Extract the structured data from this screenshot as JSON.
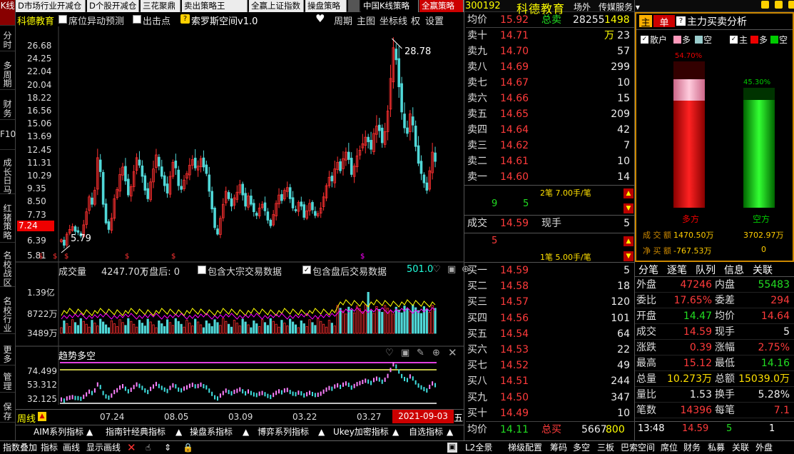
{
  "top_menu": [
    "D市场行业开减仓",
    "D个股开减仓",
    "三花聚鼎",
    "卖出策略王",
    "全赢上证指数",
    "操盘策略",
    "中国K线策略",
    "全赢策略"
  ],
  "stock": {
    "code": "300192",
    "name": "科德教育",
    "venue": "场外",
    "sector": "传媒服务 ▾"
  },
  "left_tabs": [
    "K线",
    "分时",
    "多周期",
    "财务",
    "F10",
    "成长日马",
    "红猪策略",
    "名校战区",
    "名校行业",
    "更多",
    "管理",
    "保存"
  ],
  "chart_header": {
    "name": "科德教育",
    "checkbox1": "席位异动预测",
    "checkbox2": "出击点",
    "indicator": "索罗斯空间v1.0",
    "menu": [
      "周期",
      "主图",
      "坐标线",
      "权",
      "设置"
    ]
  },
  "price_axis": [
    "26.68",
    "24.25",
    "22.04",
    "20.04",
    "18.22",
    "16.56",
    "15.06",
    "13.69",
    "12.45",
    "11.31",
    "10.29",
    "9.35",
    "8.50",
    "7.73",
    "7.24",
    "6.39",
    "5.81"
  ],
  "current_price_tag": "7.24",
  "annotations": {
    "high": "28.78",
    "low": "5.79"
  },
  "volume_panel": {
    "label": "成交量",
    "value": "4247.70万",
    "after_hours": "( 盘后: 0",
    "opt1": "包含大宗交易数据",
    "opt2": "包含盘后交易数据",
    "ma": "501.0",
    "axis": [
      "1.39亿",
      "8722万",
      "3489万"
    ]
  },
  "trend_panel": {
    "title": "趋势多空",
    "axis": [
      "74.499",
      "53.312",
      "32.125"
    ]
  },
  "date_axis": [
    "07.24",
    "08.05",
    "03.09",
    "03.22",
    "03.27"
  ],
  "period": "周线",
  "date_marker": "2021-09-03",
  "weekday": "五",
  "indicator_tabs": [
    "AIM系列指标",
    "指南针经典指标",
    "操盘系指标",
    "博弈系列指标",
    "Ukey加密指标",
    "自选指标"
  ],
  "order_book": {
    "avg_label": "均价",
    "avg": "15.92",
    "sell_total_label": "总卖",
    "sell_total": "28255",
    "sell_amount": "1498万",
    "asks": [
      {
        "l": "卖十",
        "p": "14.71",
        "v": "23"
      },
      {
        "l": "卖九",
        "p": "14.70",
        "v": "57"
      },
      {
        "l": "卖八",
        "p": "14.69",
        "v": "299"
      },
      {
        "l": "卖七",
        "p": "14.67",
        "v": "10"
      },
      {
        "l": "卖六",
        "p": "14.66",
        "v": "15"
      },
      {
        "l": "卖五",
        "p": "14.65",
        "v": "209"
      },
      {
        "l": "卖四",
        "p": "14.64",
        "v": "42"
      },
      {
        "l": "卖三",
        "p": "14.62",
        "v": "7"
      },
      {
        "l": "卖二",
        "p": "14.61",
        "v": "10"
      },
      {
        "l": "卖一",
        "p": "14.60",
        "v": "14"
      }
    ],
    "ask_info": "2笔 7.00手/笔",
    "ask_queue": [
      "9",
      "5"
    ],
    "trade_label": "成交",
    "trade_price": "14.59",
    "hand_label": "现手",
    "hand": "5",
    "bid_queue": "5",
    "bid_info": "1笔 5.00手/笔",
    "bids": [
      {
        "l": "买一",
        "p": "14.59",
        "v": "5"
      },
      {
        "l": "买二",
        "p": "14.58",
        "v": "18"
      },
      {
        "l": "买三",
        "p": "14.57",
        "v": "120"
      },
      {
        "l": "买四",
        "p": "14.56",
        "v": "101"
      },
      {
        "l": "买五",
        "p": "14.54",
        "v": "64"
      },
      {
        "l": "买六",
        "p": "14.53",
        "v": "22"
      },
      {
        "l": "买七",
        "p": "14.52",
        "v": "49"
      },
      {
        "l": "买八",
        "p": "14.51",
        "v": "244"
      },
      {
        "l": "买九",
        "p": "14.50",
        "v": "347"
      },
      {
        "l": "买十",
        "p": "14.49",
        "v": "10"
      }
    ],
    "buy_avg_label": "均价",
    "buy_avg": "14.11",
    "buy_total_label": "总买",
    "buy_total": "5667",
    "buy_amount": "800万"
  },
  "fund_panel": {
    "tab1": "主",
    "tab2": "单",
    "title": "主力买卖分析",
    "cb1": "散户",
    "cb1a": "多",
    "cb1b": "空",
    "cb2": "主",
    "cb2a": "多",
    "cb2b": "空",
    "bull_pct": "54.70%",
    "bear_pct": "45.30%",
    "bull_label": "多方",
    "bear_label": "空方",
    "amount_label": "成 交 额",
    "bull_amount": "1470.50万",
    "bear_amount": "3702.97万",
    "net_label": "净 买 额",
    "bull_net": "-767.53万",
    "bear_net": "0",
    "bull_fill": 0.73,
    "bull_pink": 0.25,
    "bear_fill": 0.72
  },
  "info_tabs": [
    "分笔",
    "逐笔",
    "队列",
    "信息",
    "关联"
  ],
  "stats": [
    {
      "a": "外盘",
      "b": "47246",
      "c": "内盘",
      "d": "55483",
      "bc": "red",
      "dc": "grn"
    },
    {
      "a": "委比",
      "b": "17.65%",
      "c": "委差",
      "d": "294",
      "bc": "red",
      "dc": "red"
    },
    {
      "a": "开盘",
      "b": "14.47",
      "c": "均价",
      "d": "14.64",
      "bc": "grn",
      "dc": "red"
    },
    {
      "a": "成交",
      "b": "14.59",
      "c": "现手",
      "d": "5",
      "bc": "red",
      "dc": "w"
    },
    {
      "a": "涨跌",
      "b": "0.39",
      "c": "涨幅",
      "d": "2.75%",
      "bc": "red",
      "dc": "red"
    },
    {
      "a": "最高",
      "b": "15.12",
      "c": "最低",
      "d": "14.16",
      "bc": "red",
      "dc": "grn"
    },
    {
      "a": "总量",
      "b": "10.273万",
      "c": "总额",
      "d": "15039.0万",
      "bc": "ylw",
      "dc": "ylw"
    },
    {
      "a": "量比",
      "b": "1.53",
      "c": "换手",
      "d": "5.28%",
      "bc": "w",
      "dc": "w"
    },
    {
      "a": "笔数",
      "b": "14396",
      "c": "每笔",
      "d": "7.1",
      "bc": "red",
      "dc": "red"
    }
  ],
  "tick": {
    "time": "13:48",
    "price": "14.59",
    "vol": "5",
    "n": "1"
  },
  "status_bar": [
    "指数叠加",
    "指标",
    "画线",
    "显示画线",
    "L2全景",
    "梯级配置",
    "筹码",
    "多空",
    "三板",
    "巴索空间",
    "席位",
    "财务",
    "私募",
    "关联",
    "外盘"
  ],
  "chart_data": {
    "type": "candlestick",
    "note_ylim": [
      5.81,
      28.78
    ],
    "x_ticks": [
      "07.24",
      "08.05",
      "03.09",
      "03.22",
      "03.27"
    ],
    "closes": [
      7.2,
      6.6,
      7.8,
      8.3,
      8.6,
      8.1,
      8.0,
      7.6,
      8.8,
      10.2,
      11.8,
      11.0,
      12.5,
      16.0,
      14.5,
      11.0,
      9.0,
      8.3,
      9.5,
      11.6,
      12.6,
      14.2,
      15.0,
      13.5,
      12.0,
      12.9,
      14.5,
      16.0,
      15.2,
      14.0,
      12.5,
      11.6,
      13.4,
      14.8,
      16.3,
      15.1,
      14.0,
      13.0,
      12.2,
      14.0,
      15.5,
      14.9,
      13.0,
      12.6,
      13.6,
      14.3,
      15.2,
      15.8,
      14.9,
      15.1,
      15.9,
      15.0,
      14.3,
      12.4,
      10.5,
      8.5,
      7.8,
      9.5,
      11.0,
      12.4,
      11.6,
      10.8,
      11.7,
      12.3,
      13.1,
      12.0,
      10.8,
      11.9,
      11.0,
      10.2,
      9.8,
      10.6,
      11.0,
      10.3,
      9.3,
      8.7,
      9.9,
      11.1,
      12.0,
      11.4,
      12.5,
      12.8,
      11.6,
      10.6,
      10.3,
      11.2,
      10.8,
      9.6,
      10.3,
      11.1,
      10.4,
      9.8,
      10.0,
      10.6,
      11.8,
      13.0,
      13.9,
      13.5,
      14.8,
      15.5,
      14.6,
      15.9,
      16.6,
      15.8,
      14.2,
      15.1,
      16.2,
      16.8,
      17.5,
      18.2,
      17.7,
      16.9,
      18.6,
      19.4,
      18.9,
      17.6,
      18.8,
      21.0,
      24.5,
      27.8,
      26.5,
      23.6,
      20.9,
      19.2,
      18.6,
      20.7,
      19.5,
      17.2,
      15.4,
      14.3,
      13.3,
      12.5,
      14.6,
      16.6,
      15.6
    ]
  }
}
